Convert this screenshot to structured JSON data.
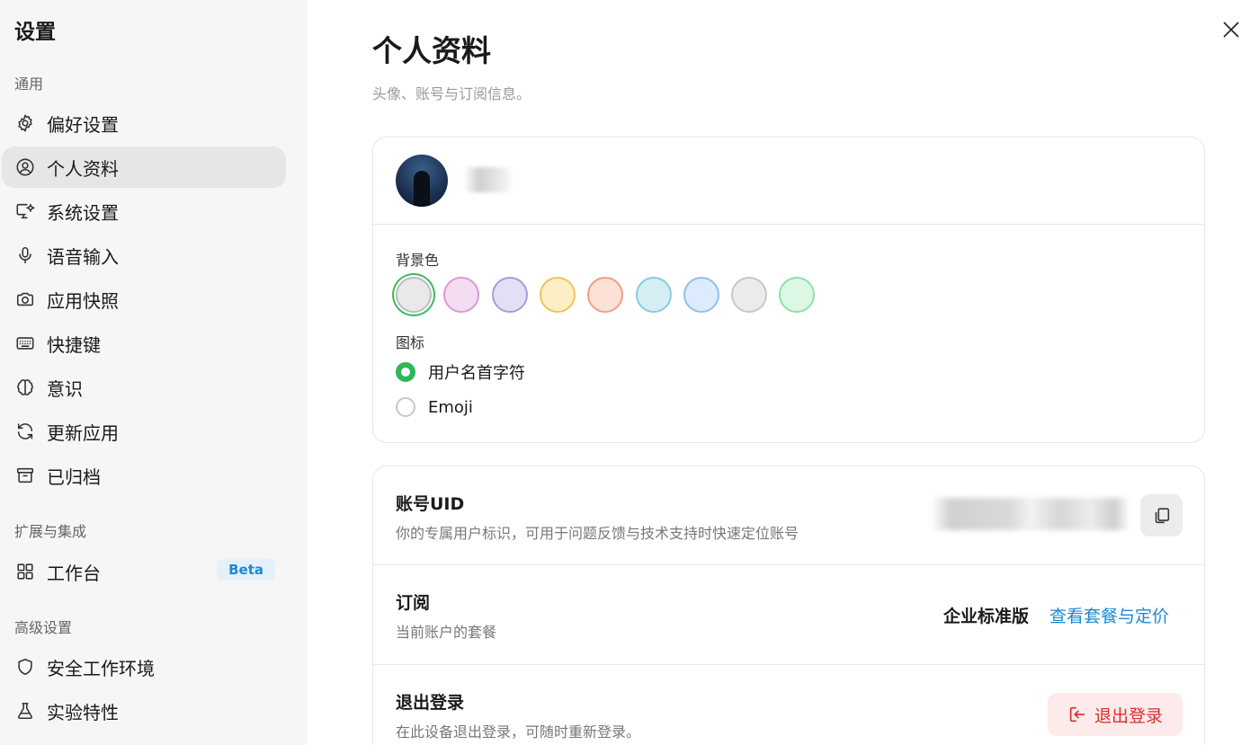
{
  "sidebar": {
    "title": "设置",
    "sections": {
      "general": "通用",
      "extensions": "扩展与集成",
      "advanced": "高级设置"
    },
    "items": [
      {
        "label": "偏好设置",
        "icon": "gear-icon"
      },
      {
        "label": "个人资料",
        "icon": "user-circle-icon"
      },
      {
        "label": "系统设置",
        "icon": "monitor-gear-icon"
      },
      {
        "label": "语音输入",
        "icon": "microphone-icon"
      },
      {
        "label": "应用快照",
        "icon": "camera-icon"
      },
      {
        "label": "快捷键",
        "icon": "keyboard-icon"
      },
      {
        "label": "意识",
        "icon": "brain-icon"
      },
      {
        "label": "更新应用",
        "icon": "refresh-icon"
      },
      {
        "label": "已归档",
        "icon": "archive-icon"
      },
      {
        "label": "工作台",
        "icon": "grid-icon",
        "badge": "Beta"
      },
      {
        "label": "安全工作环境",
        "icon": "shield-icon"
      },
      {
        "label": "实验特性",
        "icon": "flask-icon"
      }
    ],
    "active_item": "个人资料"
  },
  "header": {
    "title": "个人资料",
    "subtitle": "头像、账号与订阅信息。"
  },
  "profile_card": {
    "background_label": "背景色",
    "swatches": [
      {
        "fill": "#e9e9e9",
        "border": "#bdbdbd",
        "selected": true
      },
      {
        "fill": "#f4dcf2",
        "border": "#d99ad6"
      },
      {
        "fill": "#e3dff5",
        "border": "#a89ad9"
      },
      {
        "fill": "#fdeec6",
        "border": "#f3c25b"
      },
      {
        "fill": "#fde0d6",
        "border": "#ef9f84"
      },
      {
        "fill": "#d4eef4",
        "border": "#84cedf"
      },
      {
        "fill": "#dcebfd",
        "border": "#8fc0ef"
      },
      {
        "fill": "#ebebeb",
        "border": "#c7c7c7"
      },
      {
        "fill": "#dcf8e4",
        "border": "#8fe0a6"
      }
    ],
    "icon_label": "图标",
    "icon_options": [
      {
        "label": "用户名首字符",
        "checked": true
      },
      {
        "label": "Emoji",
        "checked": false
      }
    ]
  },
  "account_card": {
    "uid_title": "账号UID",
    "uid_desc": "你的专属用户标识，可用于问题反馈与技术支持时快速定位账号",
    "subscription_title": "订阅",
    "subscription_desc": "当前账户的套餐",
    "plan_name": "企业标准版",
    "plan_link": "查看套餐与定价",
    "logout_title": "退出登录",
    "logout_desc": "在此设备退出登录，可随时重新登录。",
    "logout_button": "退出登录"
  },
  "colors": {
    "accent_green": "#2fb757",
    "link_blue": "#1e88d0",
    "danger_red": "#d9302c"
  }
}
